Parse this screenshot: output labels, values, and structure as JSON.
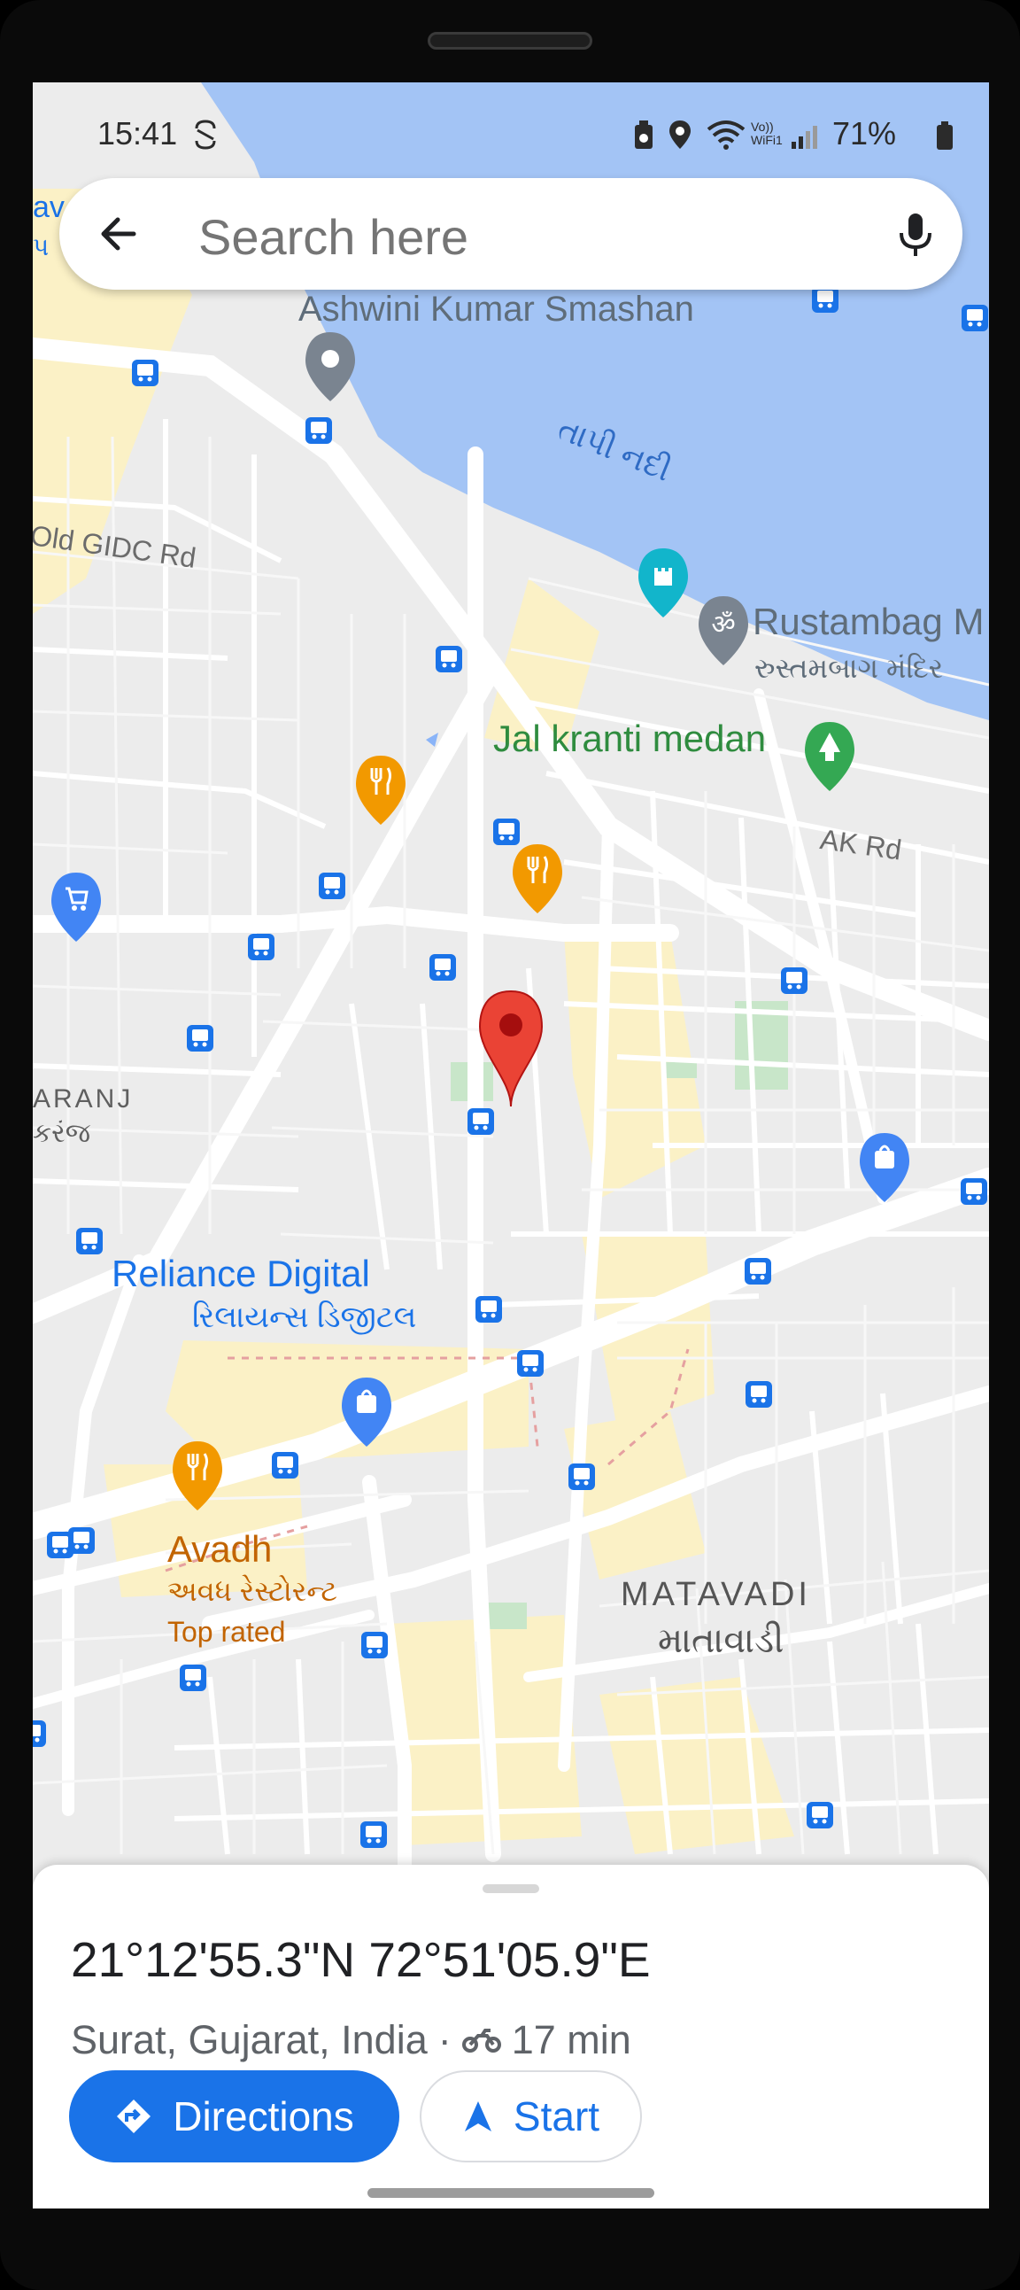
{
  "status_bar": {
    "time": "15:41",
    "battery": "71%",
    "network_label": "Vo)) WiFi1"
  },
  "search": {
    "placeholder": "Search here"
  },
  "map": {
    "labels": {
      "ashwini": "Ashwini Kumar Smashan",
      "river": "તાપી નદી",
      "old_gidc": "Old GIDC Rd",
      "rustambag": "Rustambag M",
      "rustambag_guj": "રુસ્તમબાગ મંદિર",
      "jal_kranti": "Jal kranti medan",
      "ak_rd": "AK Rd",
      "aranj": "ARANJ",
      "karanj_guj": "કરંજ",
      "reliance": "Reliance Digital",
      "reliance_guj": "રિલાયન્સ ડિજીટલ",
      "avadh": "Avadh",
      "avadh_guj": "અવધ રેસ્ટોરન્ટ",
      "top_rated": "Top rated",
      "matavadi": "MATAVADI",
      "matavadi_guj": "માતાવાડી",
      "left_edge_1": "av",
      "left_edge_2": "પ"
    }
  },
  "place": {
    "coordinates": "21°12'55.3\"N 72°51'05.9\"E",
    "location": "Surat, Gujarat, India",
    "separator": "·",
    "travel_time": "17 min",
    "directions_label": "Directions",
    "start_label": "Start"
  },
  "colors": {
    "accent": "#1a73e8",
    "water": "#a3c4f5",
    "pin_red": "#ea4335",
    "food_orange": "#f29900",
    "park_green": "#34a853",
    "shopping_blue": "#4285f4",
    "land": "#ececec",
    "road": "#ffffff",
    "commercial": "#fbf1c6"
  }
}
